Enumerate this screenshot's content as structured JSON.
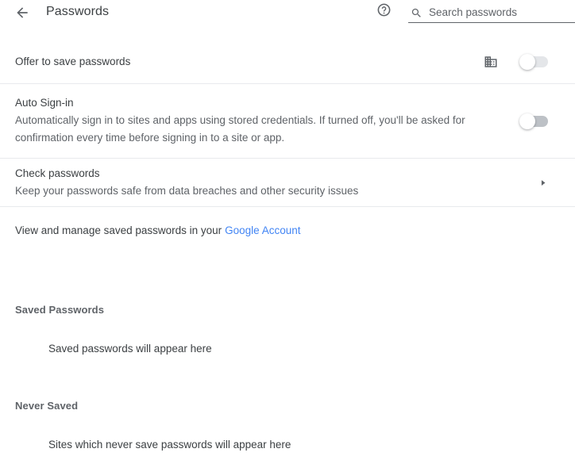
{
  "header": {
    "back_icon": "back-arrow-icon",
    "title": "Passwords",
    "help_icon": "help-circle-icon",
    "search_icon": "search-icon",
    "search_placeholder": "Search passwords",
    "search_value": ""
  },
  "settings": {
    "offer_to_save": {
      "title": "Offer to save passwords",
      "managed_icon": "enterprise-building-icon",
      "toggle_state": "off"
    },
    "auto_signin": {
      "title": "Auto Sign-in",
      "description": "Automatically sign in to sites and apps using stored credentials. If turned off, you'll be asked for confirmation every time before signing in to a site or app.",
      "toggle_state": "off"
    },
    "check_passwords": {
      "title": "Check passwords",
      "description": "Keep your passwords safe from data breaches and other security issues",
      "chevron_icon": "chevron-right-icon"
    }
  },
  "manage": {
    "text": "View and manage saved passwords in your",
    "link_label": "Google Account"
  },
  "saved_passwords": {
    "header": "Saved Passwords",
    "empty_text": "Saved passwords will appear here"
  },
  "never_saved": {
    "header": "Never Saved",
    "empty_text": "Sites which never save passwords will appear here"
  },
  "colors": {
    "link": "#4285f4",
    "text_primary": "#3c4043",
    "text_secondary": "#5f6368",
    "divider": "#e8eaed"
  }
}
